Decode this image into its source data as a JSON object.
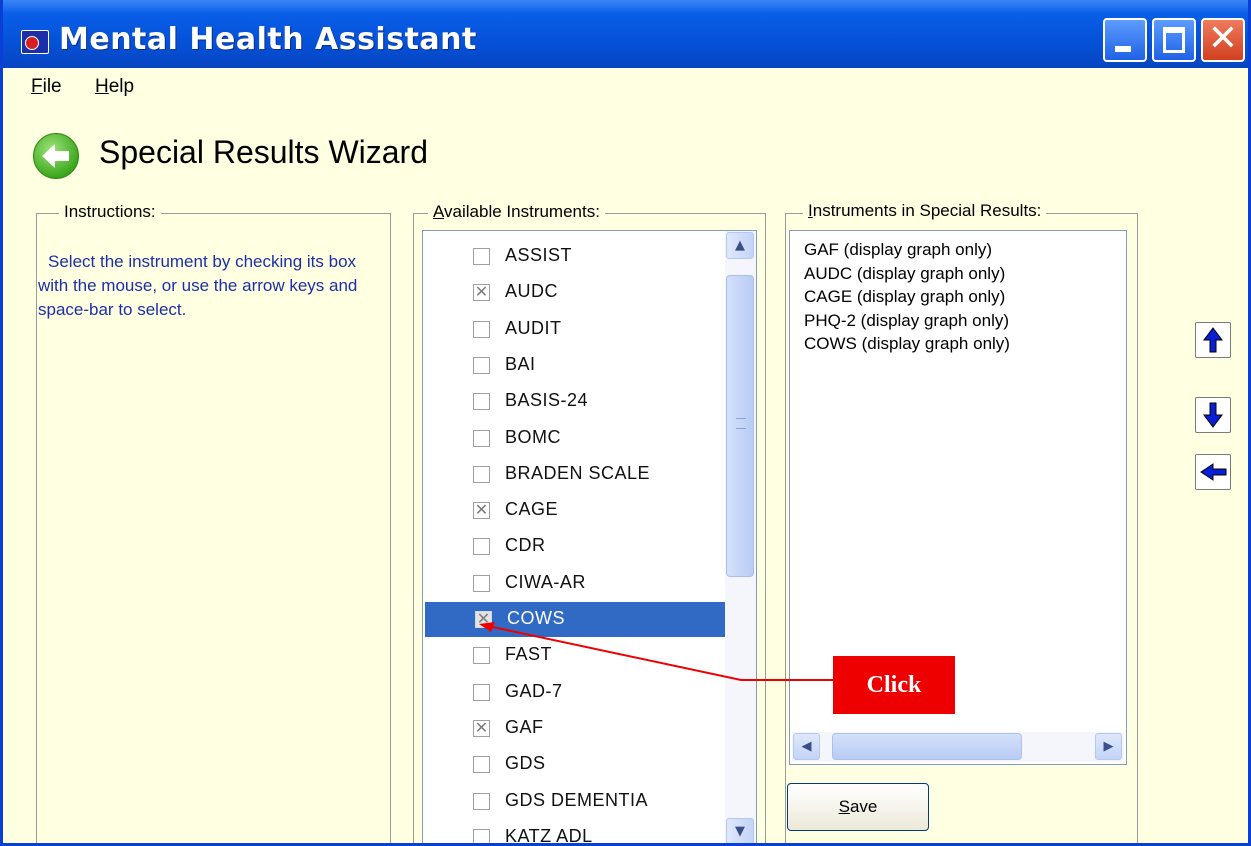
{
  "window": {
    "title": "Mental Health Assistant"
  },
  "menu": {
    "file": "File",
    "help": "Help"
  },
  "wizard": {
    "title": "Special Results Wizard"
  },
  "instructions": {
    "label": "Instructions:",
    "text": "Select the instrument by checking its box with the mouse, or use the arrow keys and space-bar to select."
  },
  "available": {
    "label": "Available Instruments:",
    "items": [
      {
        "name": "ASSIST",
        "checked": false
      },
      {
        "name": "AUDC",
        "checked": true
      },
      {
        "name": "AUDIT",
        "checked": false
      },
      {
        "name": "BAI",
        "checked": false
      },
      {
        "name": "BASIS-24",
        "checked": false
      },
      {
        "name": "BOMC",
        "checked": false
      },
      {
        "name": "BRADEN SCALE",
        "checked": false
      },
      {
        "name": "CAGE",
        "checked": true
      },
      {
        "name": "CDR",
        "checked": false
      },
      {
        "name": "CIWA-AR",
        "checked": false
      },
      {
        "name": "COWS",
        "checked": true,
        "selected": true
      },
      {
        "name": "FAST",
        "checked": false
      },
      {
        "name": "GAD-7",
        "checked": false
      },
      {
        "name": "GAF",
        "checked": true
      },
      {
        "name": "GDS",
        "checked": false
      },
      {
        "name": "GDS DEMENTIA",
        "checked": false
      },
      {
        "name": "KATZ ADL",
        "checked": false
      }
    ]
  },
  "special": {
    "label": "Instruments in Special Results:",
    "items": [
      "GAF (display graph only)",
      "AUDC (display graph only)",
      "CAGE (display graph only)",
      "PHQ-2 (display graph only)",
      "COWS (display graph only)"
    ]
  },
  "buttons": {
    "save": "Save"
  },
  "callout": {
    "text": "Click"
  },
  "colors": {
    "accent": "#316ac5",
    "background": "#ffffe1",
    "callout": "#ee0000",
    "titlebar": "#0552d9"
  },
  "icons": {
    "back": "back-arrow-icon",
    "up": "up-arrow-icon",
    "down": "down-arrow-icon",
    "remove": "left-arrow-icon"
  }
}
